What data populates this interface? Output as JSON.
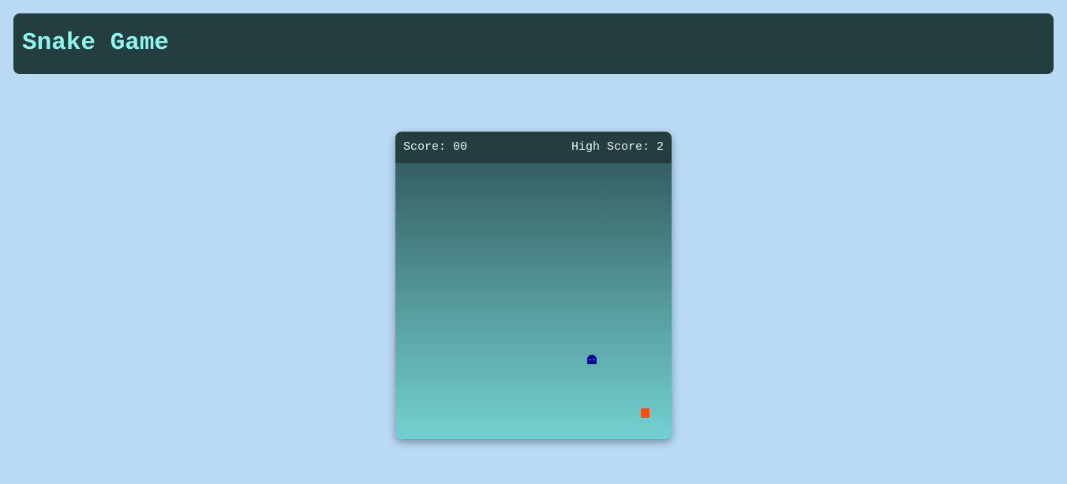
{
  "header": {
    "title": "Snake Game",
    "background_color": "#243e40",
    "title_color": "#8ff6ef"
  },
  "game": {
    "score_label": "Score: 00",
    "high_score_label": "High Score: 2",
    "board_gradient": [
      "#355f62",
      "#73d0d0"
    ],
    "snake_color": "#0c0591",
    "food_color": "#fb4d12"
  }
}
